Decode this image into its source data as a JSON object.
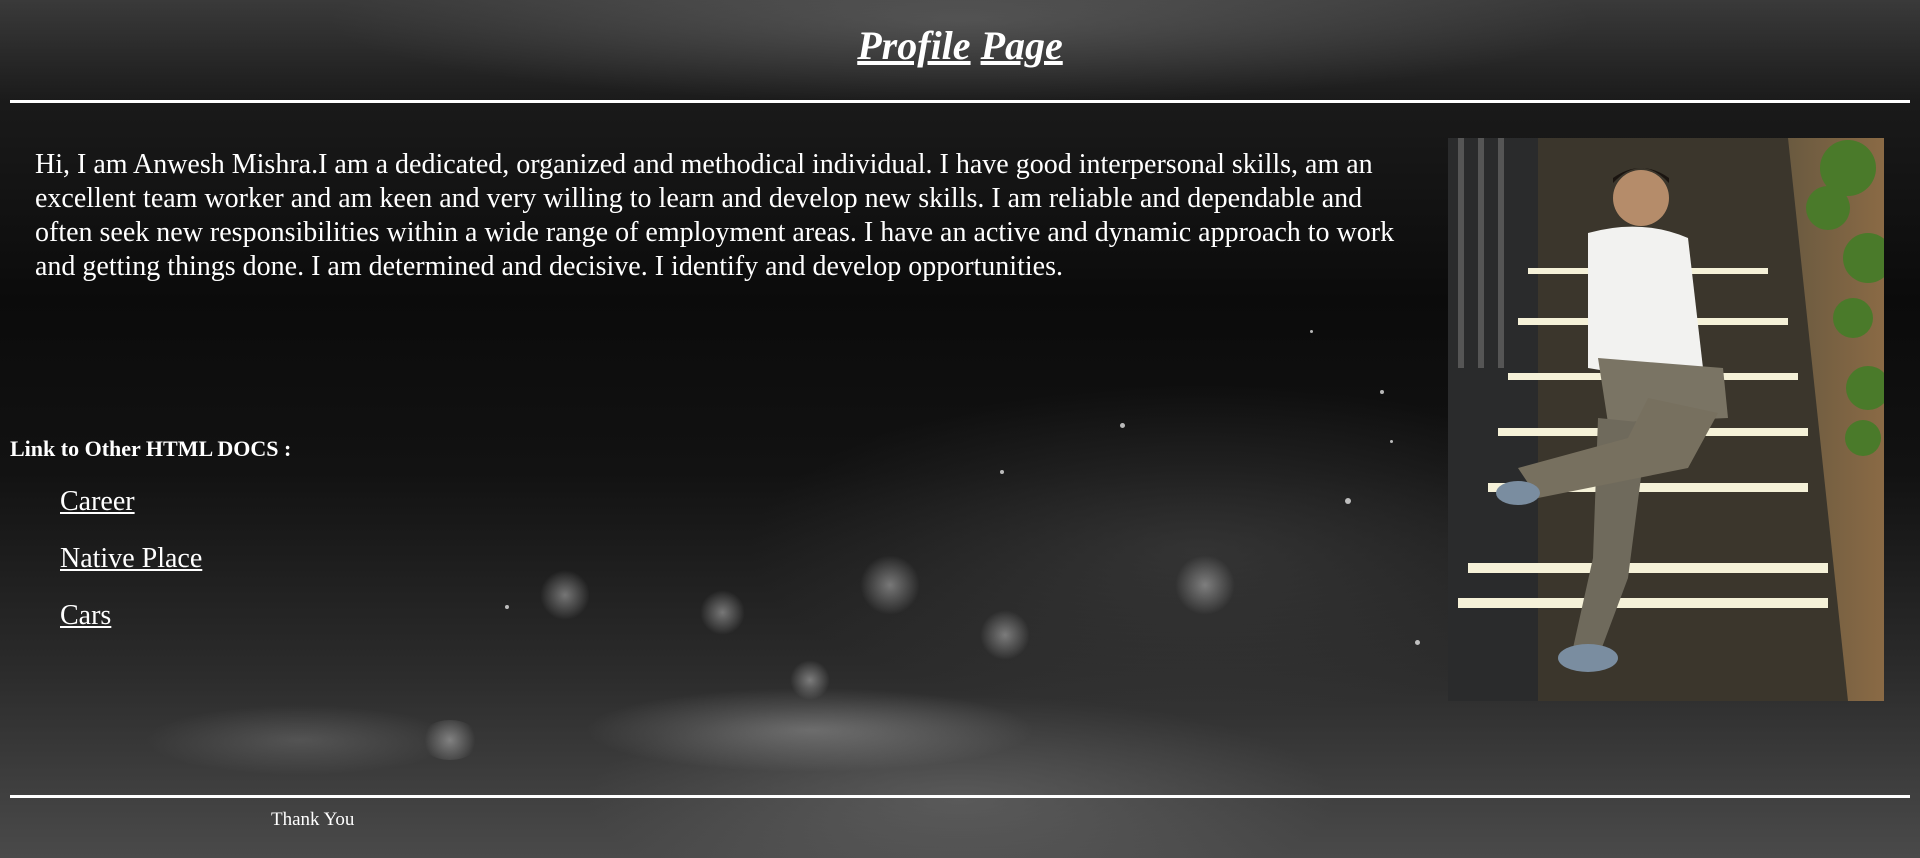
{
  "header": {
    "title_words": [
      "Profile",
      "Page"
    ]
  },
  "bio": {
    "text": "Hi, I am Anwesh Mishra.I am a dedicated, organized and methodical individual. I have good interpersonal skills, am an excellent team worker and am keen and very willing to learn and develop new skills. I am reliable and dependable and often seek new responsibilities within a wide range of employment areas. I have an active and dynamic approach to work and getting things done. I am determined and decisive. I identify and develop opportunities."
  },
  "links": {
    "heading": "Link to Other HTML DOCS :",
    "items": [
      {
        "label": "Career"
      },
      {
        "label": "Native Place"
      },
      {
        "label": "Cars"
      }
    ]
  },
  "footer": {
    "text": "Thank You"
  },
  "colors": {
    "text": "#ffffff",
    "background": "#0b0b0b"
  }
}
